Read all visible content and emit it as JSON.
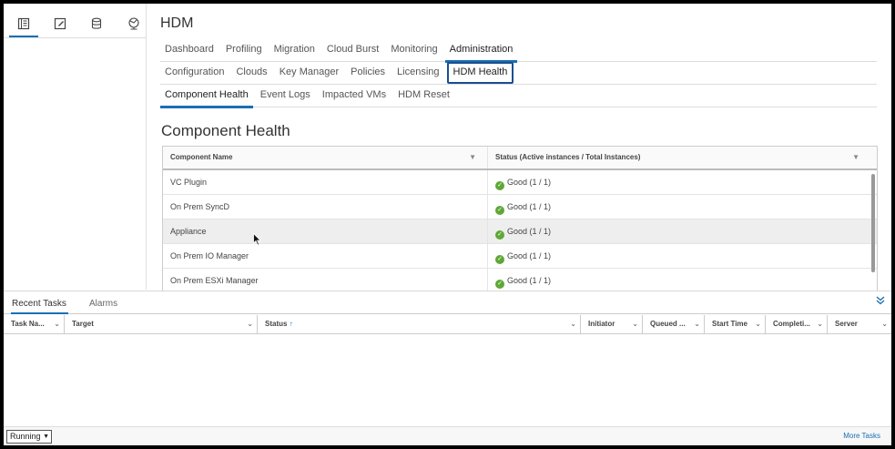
{
  "app": {
    "title": "HDM"
  },
  "sidebar": {
    "icons": [
      "hosts-icon",
      "vms-icon",
      "storage-icon",
      "network-icon"
    ]
  },
  "tabs": {
    "primary": [
      {
        "label": "Dashboard"
      },
      {
        "label": "Profiling"
      },
      {
        "label": "Migration"
      },
      {
        "label": "Cloud Burst"
      },
      {
        "label": "Monitoring"
      },
      {
        "label": "Administration",
        "active": true
      }
    ],
    "secondary": [
      {
        "label": "Configuration"
      },
      {
        "label": "Clouds"
      },
      {
        "label": "Key Manager"
      },
      {
        "label": "Policies"
      },
      {
        "label": "Licensing"
      },
      {
        "label": "HDM Health",
        "active": true
      }
    ],
    "tertiary": [
      {
        "label": "Component Health",
        "active": true
      },
      {
        "label": "Event Logs"
      },
      {
        "label": "Impacted VMs"
      },
      {
        "label": "HDM Reset"
      }
    ]
  },
  "section": {
    "title": "Component Health"
  },
  "grid": {
    "columns": [
      "Component Name",
      "Status (Active instances / Total Instances)"
    ],
    "rows": [
      {
        "name": "VC Plugin",
        "status": "Good (1 / 1)"
      },
      {
        "name": "On Prem SyncD",
        "status": "Good (1 / 1)"
      },
      {
        "name": "Appliance",
        "status": "Good (1 / 1)"
      },
      {
        "name": "On Prem IO Manager",
        "status": "Good (1 / 1)"
      },
      {
        "name": "On Prem ESXi Manager",
        "status": "Good (1 / 1)"
      }
    ],
    "status_color": "#5fa737"
  },
  "tasks": {
    "tabs": [
      "Recent Tasks",
      "Alarms"
    ],
    "columns": [
      "Task Na...",
      "Target",
      "Status",
      "Initiator",
      "Queued ...",
      "Start Time",
      "Completi...",
      "Server"
    ],
    "filter_value": "Running",
    "more_label": "More Tasks"
  },
  "colors": {
    "accent": "#1a6fb3"
  }
}
